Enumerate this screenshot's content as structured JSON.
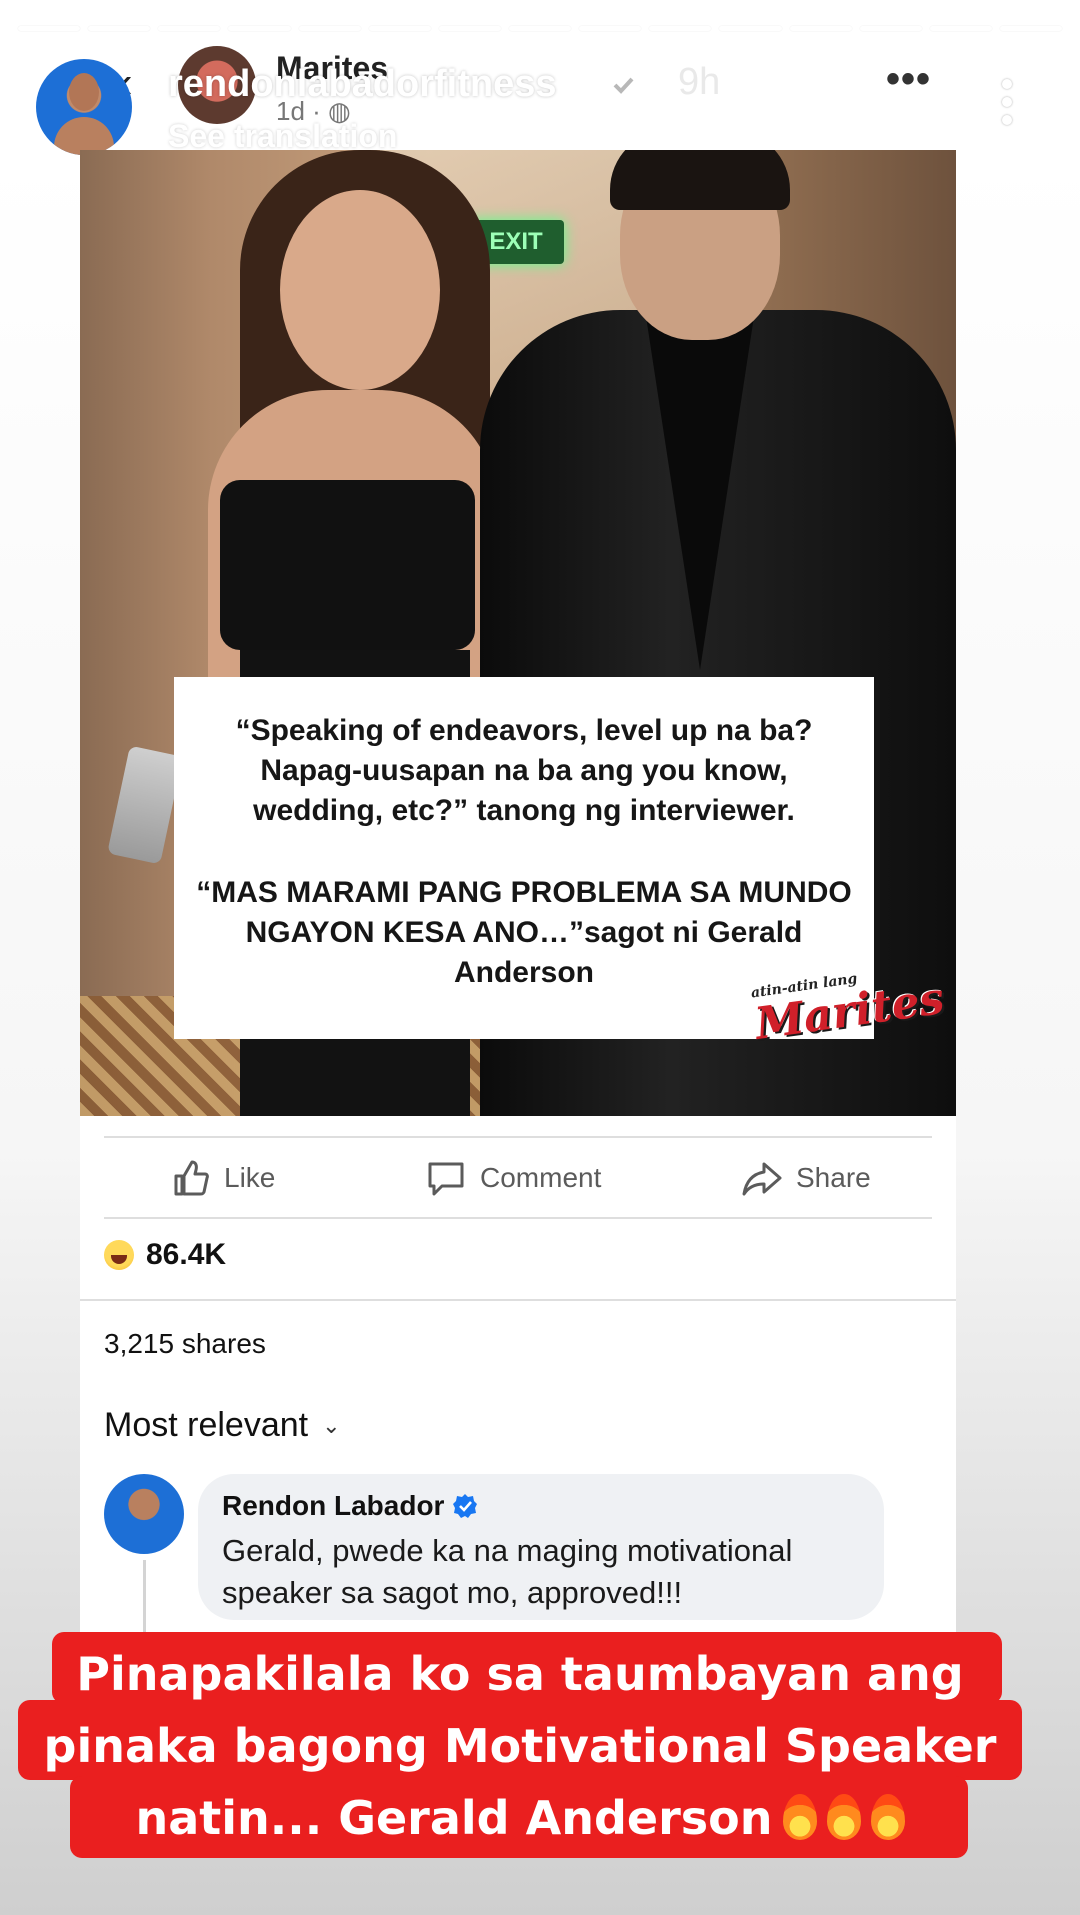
{
  "story": {
    "username": "rendonlabadorfitness",
    "time": "9h",
    "more": "•••",
    "progress_segments": 15,
    "progress_completed": 2,
    "progress_current_fraction": 0.2
  },
  "shared_post": {
    "back": "‹",
    "page_name": "Marites",
    "meta": "1d · ",
    "see_translation": "See translation",
    "image": {
      "exit_sign": "EXIT",
      "quote_question": "“Speaking of endeavors, level up na ba? Napag-uusapan na ba ang you know, wedding, etc?” tanong ng interviewer.",
      "quote_answer": "“MAS MARAMI PANG PROBLEMA SA MUNDO NGAYON KESA ANO…”sagot ni Gerald Anderson",
      "watermark": "Marites",
      "watermark_small": "atin-atin lang"
    },
    "actions": {
      "like": "Like",
      "comment": "Comment",
      "share": "Share"
    },
    "reactions_count": "86.4K",
    "shares": "3,215 shares",
    "sort_label": "Most relevant",
    "comment": {
      "author": "Rendon Labador",
      "text": "Gerald, pwede ka na maging motivational speaker sa sagot mo, approved!!!"
    }
  },
  "caption": {
    "line1": "Pinapakilala ko sa taumbayan ang",
    "line2": "pinaka bagong Motivational Speaker",
    "line3": "natin... Gerald Anderson"
  },
  "colors": {
    "caption_bg": "#ea1f1f",
    "verified_blue": "#1877f2"
  }
}
